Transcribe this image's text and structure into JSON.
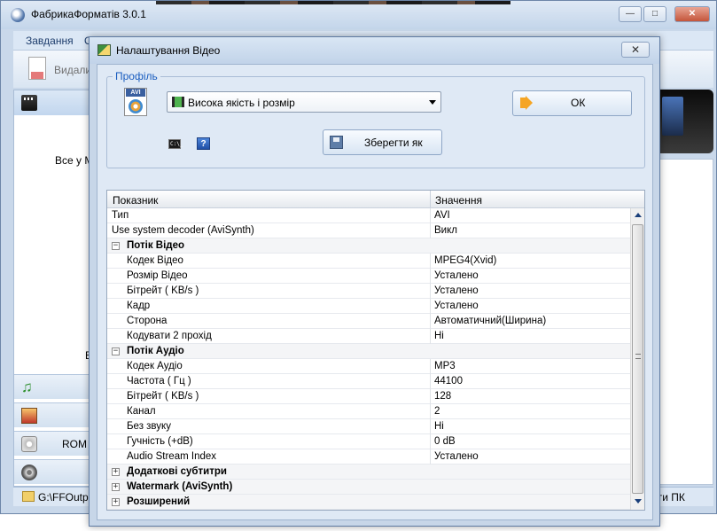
{
  "main_window": {
    "title": "ФабрикаФорматів 3.0.1",
    "menu": {
      "tasks": "Завдання",
      "other": "О"
    },
    "toolbar": {
      "delete_label": "Видали"
    },
    "sidebar": {
      "all_label": "Все у М",
      "b_label": "В",
      "rom_label": "ROM I"
    },
    "status": {
      "path": "G:\\FFOutpu",
      "right_text": "ити ПК"
    },
    "window_buttons": {
      "minimize": "—",
      "maximize": "□",
      "close": "✕"
    }
  },
  "dialog": {
    "title": "Налаштування Відео",
    "close_glyph": "✕",
    "profile_group_label": "Профіль",
    "avi_icon_label": "AVI",
    "profile_selected": "Висока якість і розмір",
    "cmd_icon_text": "C:\\_",
    "help_icon_text": "?",
    "save_as_label": "Зберегти як",
    "ok_label": "ОК",
    "grid": {
      "columns": [
        "Показник",
        "Значення"
      ],
      "rows": [
        {
          "name": "Тип",
          "value": "AVI",
          "level": 0
        },
        {
          "name": "Use system decoder (AviSynth)",
          "value": "Викл",
          "level": 0
        },
        {
          "name": "Потік Відео",
          "value": "",
          "level": 0,
          "category": true,
          "expander": "−"
        },
        {
          "name": "Кодек Відео",
          "value": "MPEG4(Xvid)",
          "level": 1
        },
        {
          "name": "Розмір Відео",
          "value": "Усталено",
          "level": 1
        },
        {
          "name": "Бітрейт ( KB/s )",
          "value": "Усталено",
          "level": 1
        },
        {
          "name": "Кадр",
          "value": "Усталено",
          "level": 1
        },
        {
          "name": "Сторона",
          "value": "Автоматичний(Ширина)",
          "level": 1
        },
        {
          "name": "Кодувати 2 прохід",
          "value": "Ні",
          "level": 1
        },
        {
          "name": "Потік Аудіо",
          "value": "",
          "level": 0,
          "category": true,
          "expander": "−"
        },
        {
          "name": "Кодек Аудіо",
          "value": "MP3",
          "level": 1
        },
        {
          "name": "Частота ( Гц )",
          "value": "44100",
          "level": 1
        },
        {
          "name": "Бітрейт ( KB/s )",
          "value": "128",
          "level": 1
        },
        {
          "name": "Канал",
          "value": "2",
          "level": 1
        },
        {
          "name": "Без звуку",
          "value": "Ні",
          "level": 1
        },
        {
          "name": "Гучність (+dB)",
          "value": "0 dB",
          "level": 1
        },
        {
          "name": "Audio Stream Index",
          "value": "Усталено",
          "level": 1
        },
        {
          "name": "Додаткові субтитри",
          "value": "",
          "level": 0,
          "category": true,
          "expander": "+"
        },
        {
          "name": "Watermark (AviSynth)",
          "value": "",
          "level": 0,
          "category": true,
          "expander": "+"
        },
        {
          "name": "Розширений",
          "value": "",
          "level": 0,
          "category": true,
          "expander": "+"
        }
      ]
    }
  }
}
